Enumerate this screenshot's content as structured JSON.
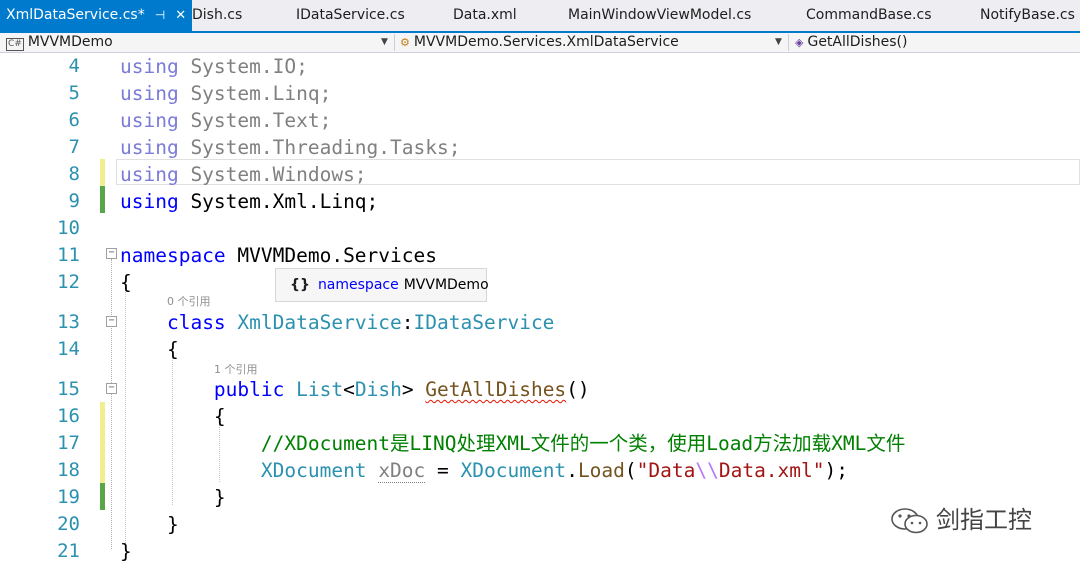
{
  "tabs": [
    {
      "label": "XmlDataService.cs*",
      "active": true,
      "pin": "⊣",
      "close": "✕"
    },
    {
      "label": "Dish.cs"
    },
    {
      "label": "IDataService.cs"
    },
    {
      "label": "Data.xml"
    },
    {
      "label": "MainWindowViewModel.cs"
    },
    {
      "label": "CommandBase.cs"
    },
    {
      "label": "NotifyBase.cs"
    }
  ],
  "navbar": {
    "project": "MVVMDemo",
    "class": "MVVMDemo.Services.XmlDataService",
    "member": "GetAllDishes()"
  },
  "lines": [
    {
      "n": "4",
      "tokens": [
        {
          "t": "using",
          "c": "kwd"
        },
        {
          "t": " System.IO;",
          "c": "dim"
        }
      ]
    },
    {
      "n": "5",
      "tokens": [
        {
          "t": "using",
          "c": "kwd"
        },
        {
          "t": " System.Linq;",
          "c": "dim"
        }
      ]
    },
    {
      "n": "6",
      "tokens": [
        {
          "t": "using",
          "c": "kwd"
        },
        {
          "t": " System.Text;",
          "c": "dim"
        }
      ]
    },
    {
      "n": "7",
      "tokens": [
        {
          "t": "using",
          "c": "kwd"
        },
        {
          "t": " System.Threading.Tasks;",
          "c": "dim"
        }
      ]
    },
    {
      "n": "8",
      "tokens": [
        {
          "t": "using",
          "c": "kwd"
        },
        {
          "t": " System.Windows;",
          "c": "dim"
        }
      ]
    },
    {
      "n": "9",
      "tokens": [
        {
          "t": "using",
          "c": "kw"
        },
        {
          "t": " System.Xml.Linq;",
          "c": ""
        }
      ]
    },
    {
      "n": "10",
      "tokens": []
    },
    {
      "n": "11",
      "tokens": [
        {
          "t": "namespace",
          "c": "kw"
        },
        {
          "t": " MVVMDemo.Services",
          "c": ""
        }
      ]
    },
    {
      "n": "12",
      "tokens": [
        {
          "t": "{",
          "c": ""
        }
      ]
    },
    {
      "n": "13",
      "tokens": [
        {
          "t": "    ",
          "c": ""
        },
        {
          "t": "class",
          "c": "kw"
        },
        {
          "t": " ",
          "c": ""
        },
        {
          "t": "XmlDataService",
          "c": "ty"
        },
        {
          "t": ":",
          "c": ""
        },
        {
          "t": "IDataService",
          "c": "ty"
        }
      ]
    },
    {
      "n": "14",
      "tokens": [
        {
          "t": "    {",
          "c": ""
        }
      ]
    },
    {
      "n": "15",
      "tokens": [
        {
          "t": "        ",
          "c": ""
        },
        {
          "t": "public",
          "c": "kw"
        },
        {
          "t": " ",
          "c": ""
        },
        {
          "t": "List",
          "c": "ty"
        },
        {
          "t": "<",
          "c": ""
        },
        {
          "t": "Dish",
          "c": "ty"
        },
        {
          "t": "> ",
          "c": ""
        },
        {
          "t": "GetAllDishes",
          "c": "mth squig"
        },
        {
          "t": "()",
          "c": ""
        }
      ]
    },
    {
      "n": "16",
      "tokens": [
        {
          "t": "        {",
          "c": ""
        }
      ]
    },
    {
      "n": "17",
      "tokens": [
        {
          "t": "            ",
          "c": ""
        },
        {
          "t": "//XDocument是LINQ处理XML文件的一个类，使用Load方法加载XML文件",
          "c": "cmt"
        }
      ]
    },
    {
      "n": "18",
      "tokens": [
        {
          "t": "            ",
          "c": ""
        },
        {
          "t": "XDocument",
          "c": "ty"
        },
        {
          "t": " ",
          "c": ""
        },
        {
          "t": "xDoc",
          "c": "dim dotted"
        },
        {
          "t": " = ",
          "c": ""
        },
        {
          "t": "XDocument",
          "c": "ty"
        },
        {
          "t": ".",
          "c": ""
        },
        {
          "t": "Load",
          "c": "mth"
        },
        {
          "t": "(",
          "c": ""
        },
        {
          "t": "\"Data",
          "c": "str"
        },
        {
          "t": "\\\\",
          "c": "esc"
        },
        {
          "t": "Data.xml\"",
          "c": "str"
        },
        {
          "t": ");",
          "c": ""
        }
      ]
    },
    {
      "n": "19",
      "tokens": [
        {
          "t": "        }",
          "c": ""
        }
      ]
    },
    {
      "n": "20",
      "tokens": [
        {
          "t": "    }",
          "c": ""
        }
      ]
    },
    {
      "n": "21",
      "tokens": [
        {
          "t": "}",
          "c": ""
        }
      ]
    }
  ],
  "refs": {
    "class_refs": "0 个引用",
    "method_refs": "1 个引用"
  },
  "tooltip": {
    "brace": "{}",
    "keyword": "namespace",
    "name": "MVVMDemo"
  },
  "watermark": "剑指工控",
  "colors": {
    "accent": "#007acc",
    "keyword": "#0000ff",
    "type": "#2b91af",
    "comment": "#008000",
    "string": "#a31515",
    "line_number": "#2b91af",
    "change_saved": "#57a64a",
    "change_unsaved": "#efef8f"
  }
}
